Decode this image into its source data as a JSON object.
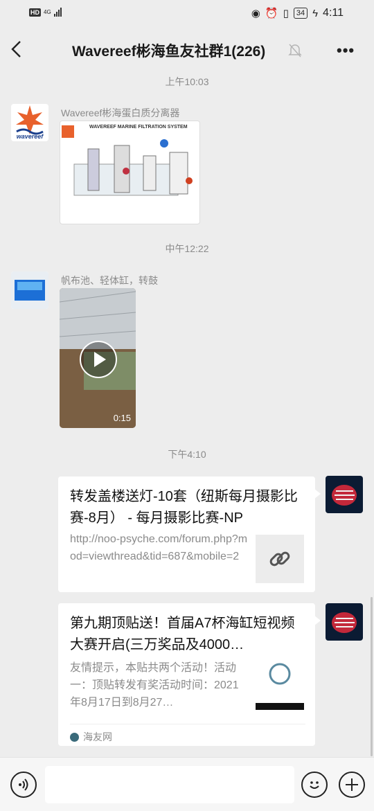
{
  "status": {
    "hd": "HD",
    "net": "4G",
    "battery": "34",
    "time": "4:11"
  },
  "header": {
    "title": "Wavereef彬海鱼友社群1(226)"
  },
  "messages": [
    {
      "time": "上午10:03",
      "sender": "Wavereef彬海蛋白质分离器",
      "image_caption": "WAVEREEF MARINE FILTRATION SYSTEM",
      "avatar_text": "wavereef"
    },
    {
      "time": "中午12:22",
      "sender": "帆布池、轻体缸，转鼓",
      "video_duration": "0:15"
    },
    {
      "time": "下午4:10",
      "link_title": "转发盖楼送灯-10套（纽斯每月摄影比赛-8月） - 每月摄影比赛-NP",
      "link_desc": "http://noo-psyche.com/forum.php?mod=viewthread&tid=687&mobile=2"
    },
    {
      "link_title": "第九期顶贴送！首届A7杯海缸短视频大赛开启(三万奖品及4000…",
      "link_desc": "友情提示，本贴共两个活动！活动一：顶贴转发有奖活动时间：2021年8月17日到8月27…",
      "source": "海友网"
    }
  ],
  "icons": {
    "back": "back-arrow-icon",
    "mute": "bell-off-icon",
    "more": "more-icon",
    "voice": "voice-icon",
    "emoji": "emoji-icon",
    "add": "plus-icon"
  }
}
